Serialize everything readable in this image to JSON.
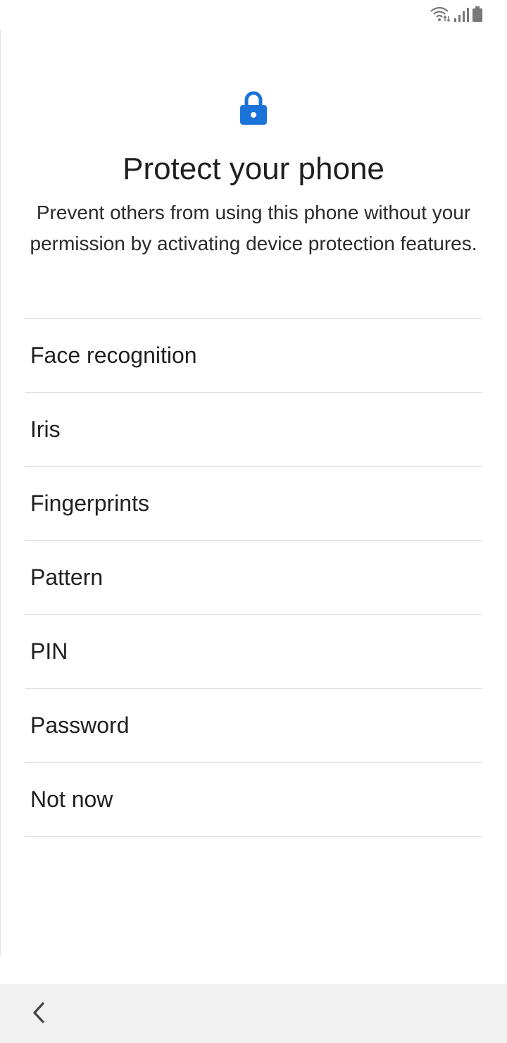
{
  "status_bar": {
    "icons": [
      "wifi-icon",
      "signal-icon",
      "battery-icon"
    ]
  },
  "header": {
    "icon": "lock-icon",
    "accent_color": "#1a73d9",
    "title": "Protect your phone",
    "subtitle": "Prevent others from using this phone without your permission by activating device protection features."
  },
  "options": [
    {
      "label": "Face recognition"
    },
    {
      "label": "Iris"
    },
    {
      "label": "Fingerprints"
    },
    {
      "label": "Pattern"
    },
    {
      "label": "PIN"
    },
    {
      "label": "Password"
    },
    {
      "label": "Not now"
    }
  ],
  "nav_bar": {
    "back_icon": "chevron-left-icon"
  }
}
